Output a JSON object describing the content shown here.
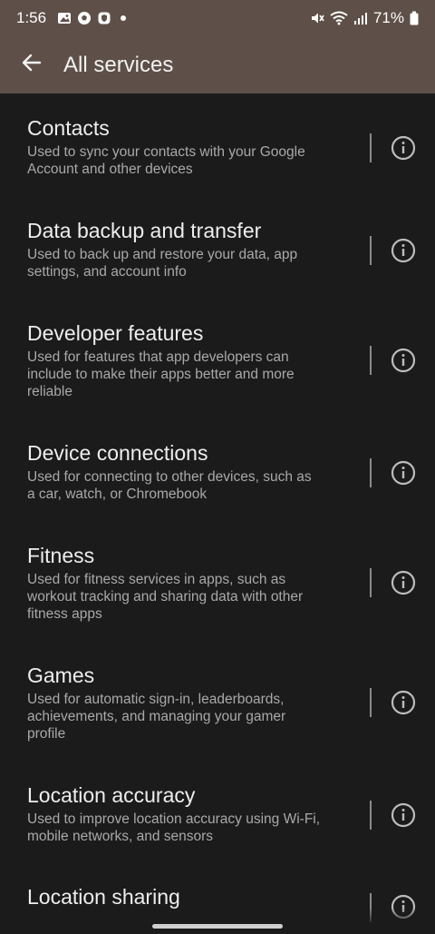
{
  "status_bar": {
    "time": "1:56",
    "battery": "71%",
    "left_icons": [
      "gallery-icon",
      "soccer-icon",
      "shield-icon",
      "dot-icon"
    ],
    "right_icons": [
      "mute-icon",
      "wifi-icon",
      "signal-icon",
      "battery-icon"
    ]
  },
  "app_bar": {
    "title": "All services",
    "back_icon": "arrow-left-icon"
  },
  "services": [
    {
      "title": "Contacts",
      "subtitle_lines": [
        "Used to sync your contacts with your Google",
        "Account and other devices"
      ]
    },
    {
      "title": "Data backup and transfer",
      "subtitle_lines": [
        "Used to back up and restore your data, app",
        "settings, and account info"
      ]
    },
    {
      "title": "Developer features",
      "subtitle_lines": [
        "Used for features that app developers can",
        "include to make their apps better and more",
        "reliable"
      ]
    },
    {
      "title": "Device connections",
      "subtitle_lines": [
        "Used for connecting to other devices, such as",
        "a car, watch, or Chromebook"
      ]
    },
    {
      "title": "Fitness",
      "subtitle_lines": [
        "Used for fitness services in apps, such as",
        "workout tracking and sharing data with other",
        "fitness apps"
      ]
    },
    {
      "title": "Games",
      "subtitle_lines": [
        "Used for automatic sign-in, leaderboards,",
        "achievements, and managing your gamer",
        "profile"
      ]
    },
    {
      "title": "Location accuracy",
      "subtitle_lines": [
        "Used to improve location accuracy using Wi-Fi,",
        "mobile networks, and sensors"
      ]
    },
    {
      "title": "Location sharing",
      "subtitle_lines": []
    }
  ],
  "colors": {
    "app_bar": "#5e5048",
    "background": "#1b1b1b",
    "title_text": "#eeeeee",
    "subtitle_text": "#a9a9a9"
  }
}
